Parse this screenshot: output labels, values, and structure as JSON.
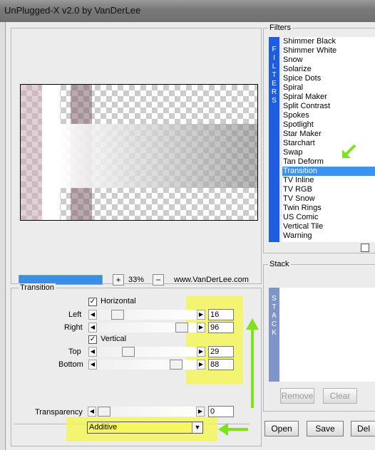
{
  "window": {
    "title": "UnPlugged-X v2.0 by VanDerLee"
  },
  "zoom": {
    "plus": "+",
    "value": "33%",
    "minus": "−",
    "website": "www.VanDerLee.com"
  },
  "transition": {
    "group_title": "Transition",
    "horizontal_label": "Horizontal",
    "horizontal_checked": true,
    "left_label": "Left",
    "left_value": "16",
    "right_label": "Right",
    "right_value": "96",
    "vertical_label": "Vertical",
    "vertical_checked": true,
    "top_label": "Top",
    "top_value": "29",
    "bottom_label": "Bottom",
    "bottom_value": "88",
    "transparency_label": "Transparency",
    "transparency_value": "0",
    "mode_selected": "Additive"
  },
  "filters": {
    "group_title": "Filters",
    "side_label": "FILTERS",
    "items": [
      "Shimmer Black",
      "Shimmer White",
      "Snow",
      "Solarize",
      "Spice Dots",
      "Spiral",
      "Spiral Maker",
      "Split Contrast",
      "Spokes",
      "Spotlight",
      "Star Maker",
      "Starchart",
      "Swap",
      "Tan Deform",
      "Transition",
      "TV Inline",
      "TV RGB",
      "TV Snow",
      "Twin Rings",
      "US Comic",
      "Vertical Tile",
      "Warning"
    ],
    "selected": "Transition"
  },
  "stack": {
    "group_title": "Stack",
    "side_label": "STACK",
    "remove_label": "Remove",
    "clear_label": "Clear"
  },
  "buttons": {
    "open": "Open",
    "save": "Save",
    "delete": "Del"
  },
  "colors": {
    "highlight": "#f6f65e",
    "arrow": "#7ee21c",
    "selection": "#3c94f0",
    "filters_side": "#1f5de0"
  }
}
